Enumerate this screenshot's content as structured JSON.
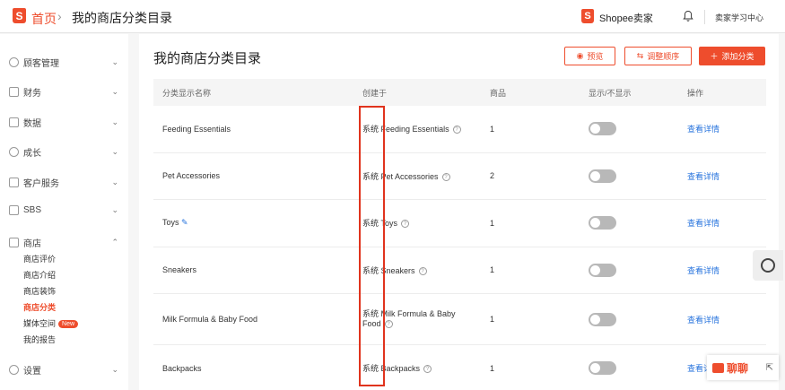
{
  "header": {
    "home": "首页",
    "separator": "›",
    "current": "我的商店分类目录",
    "seller_brand": "Shopee卖家",
    "learning_center": "卖家学习中心"
  },
  "sidebar": {
    "groups": [
      {
        "label": "顾客管理",
        "icon": "user-icon"
      },
      {
        "label": "财务",
        "icon": "wallet-icon"
      },
      {
        "label": "数据",
        "icon": "chart-icon"
      },
      {
        "label": "成长",
        "icon": "growth-icon"
      },
      {
        "label": "客户服务",
        "icon": "chat-icon"
      },
      {
        "label": "SBS",
        "icon": "box-icon"
      },
      {
        "label": "商店",
        "icon": "store-icon"
      },
      {
        "label": "设置",
        "icon": "gear-icon"
      }
    ],
    "shop_items": [
      "商店评价",
      "商店介绍",
      "商店装饰",
      "商店分类",
      "媒体空间",
      "我的报告"
    ],
    "active_item": "商店分类",
    "new_badge": "New"
  },
  "main": {
    "title": "我的商店分类目录",
    "buttons": {
      "preview": "预览",
      "reorder": "调整顺序",
      "add": "添加分类"
    },
    "columns": [
      "分类显示名称",
      "创建于",
      "商品",
      "显示/不显示",
      "操作"
    ],
    "rows": [
      {
        "name": "Feeding Essentials",
        "created_prefix": "系统",
        "created_name": "Feeding Essentials",
        "products": "1",
        "action": "查看详情"
      },
      {
        "name": "Pet Accessories",
        "created_prefix": "系统",
        "created_name": "Pet Accessories",
        "products": "2",
        "action": "查看详情"
      },
      {
        "name": "Toys",
        "created_prefix": "系统",
        "created_name": "Toys",
        "products": "1",
        "action": "查看详情"
      },
      {
        "name": "Sneakers",
        "created_prefix": "系统",
        "created_name": "Sneakers",
        "products": "1",
        "action": "查看详情"
      },
      {
        "name": "Milk Formula & Baby Food",
        "created_prefix": "系统",
        "created_name": "Milk Formula & Baby Food",
        "products": "1",
        "action": "查看详情"
      },
      {
        "name": "Backpacks",
        "created_prefix": "系统",
        "created_name": "Backpacks",
        "products": "1",
        "action": "查看详"
      }
    ]
  },
  "chat": {
    "label": "聊聊"
  },
  "colors": {
    "brand": "#ee4d2d",
    "link": "#2673dd",
    "highlight": "#e0331d"
  }
}
